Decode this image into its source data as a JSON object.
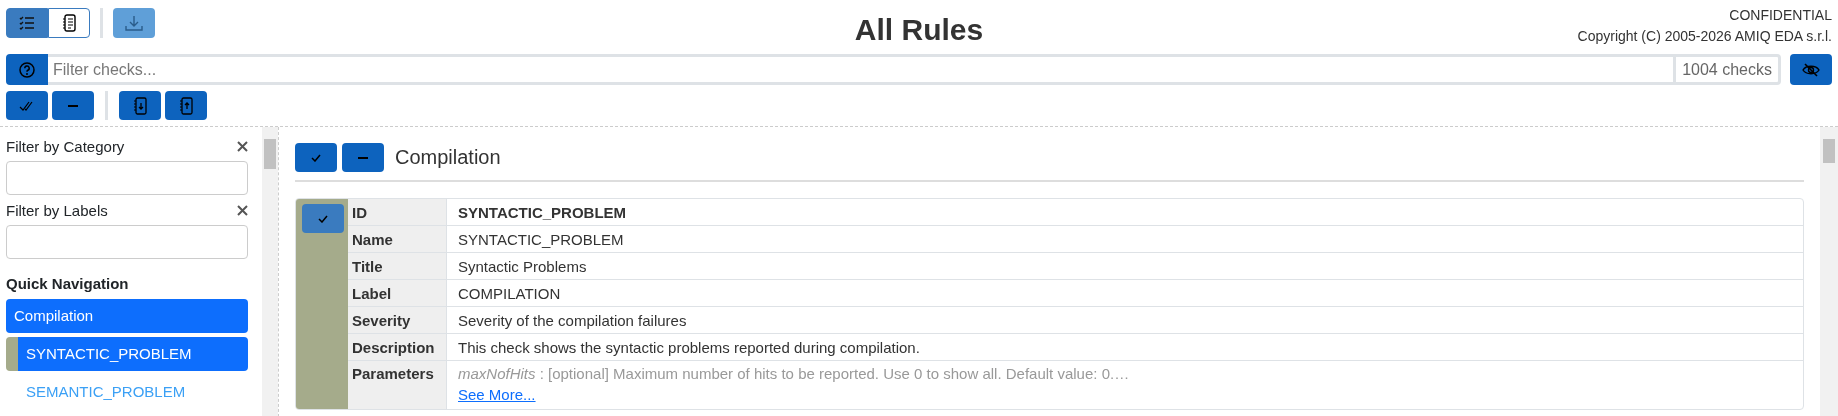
{
  "view_toggle": [
    {
      "kind": "list",
      "selected": true
    },
    {
      "kind": "document",
      "selected": false
    }
  ],
  "download_button": {
    "disabled": true
  },
  "title": "All Rules",
  "notice": [
    "CONFIDENTIAL",
    "Copyright (C) 2005-2026 AMIQ EDA s.r.l."
  ],
  "filter": {
    "placeholder": "Filter checks...",
    "count": "1004 checks"
  },
  "sidebar": {
    "filters": [
      {
        "label": "Filter by Category"
      },
      {
        "label": "Filter by Labels"
      }
    ],
    "quick_navigation": {
      "heading": "Quick Navigation",
      "items": [
        {
          "label": "Compilation",
          "kind": "category",
          "selected": true
        },
        {
          "label": "SYNTACTIC_PROBLEM",
          "kind": "check",
          "selected": true
        },
        {
          "label": "SEMANTIC_PROBLEM",
          "kind": "check",
          "selected": false
        }
      ]
    }
  },
  "section": {
    "title": "Compilation"
  },
  "check": {
    "enabled": true,
    "rows": [
      {
        "label": "ID",
        "value": "SYNTACTIC_PROBLEM",
        "kind": "id"
      },
      {
        "label": "Name",
        "value": "SYNTACTIC_PROBLEM",
        "kind": "text"
      },
      {
        "label": "Title",
        "value": "Syntactic Problems",
        "kind": "text"
      },
      {
        "label": "Label",
        "value": "COMPILATION",
        "kind": "text"
      },
      {
        "label": "Severity",
        "value": "Severity of the compilation failures",
        "kind": "text"
      },
      {
        "label": "Description",
        "value": "This check shows the syntactic problems reported during compilation.",
        "kind": "text"
      },
      {
        "label": "Parameters",
        "value": "*maxNofHits* : [optional] Maximum number of hits to be reported. Use 0 to show all. Default value: 0.…",
        "kind": "params",
        "link": "See More..."
      }
    ]
  }
}
